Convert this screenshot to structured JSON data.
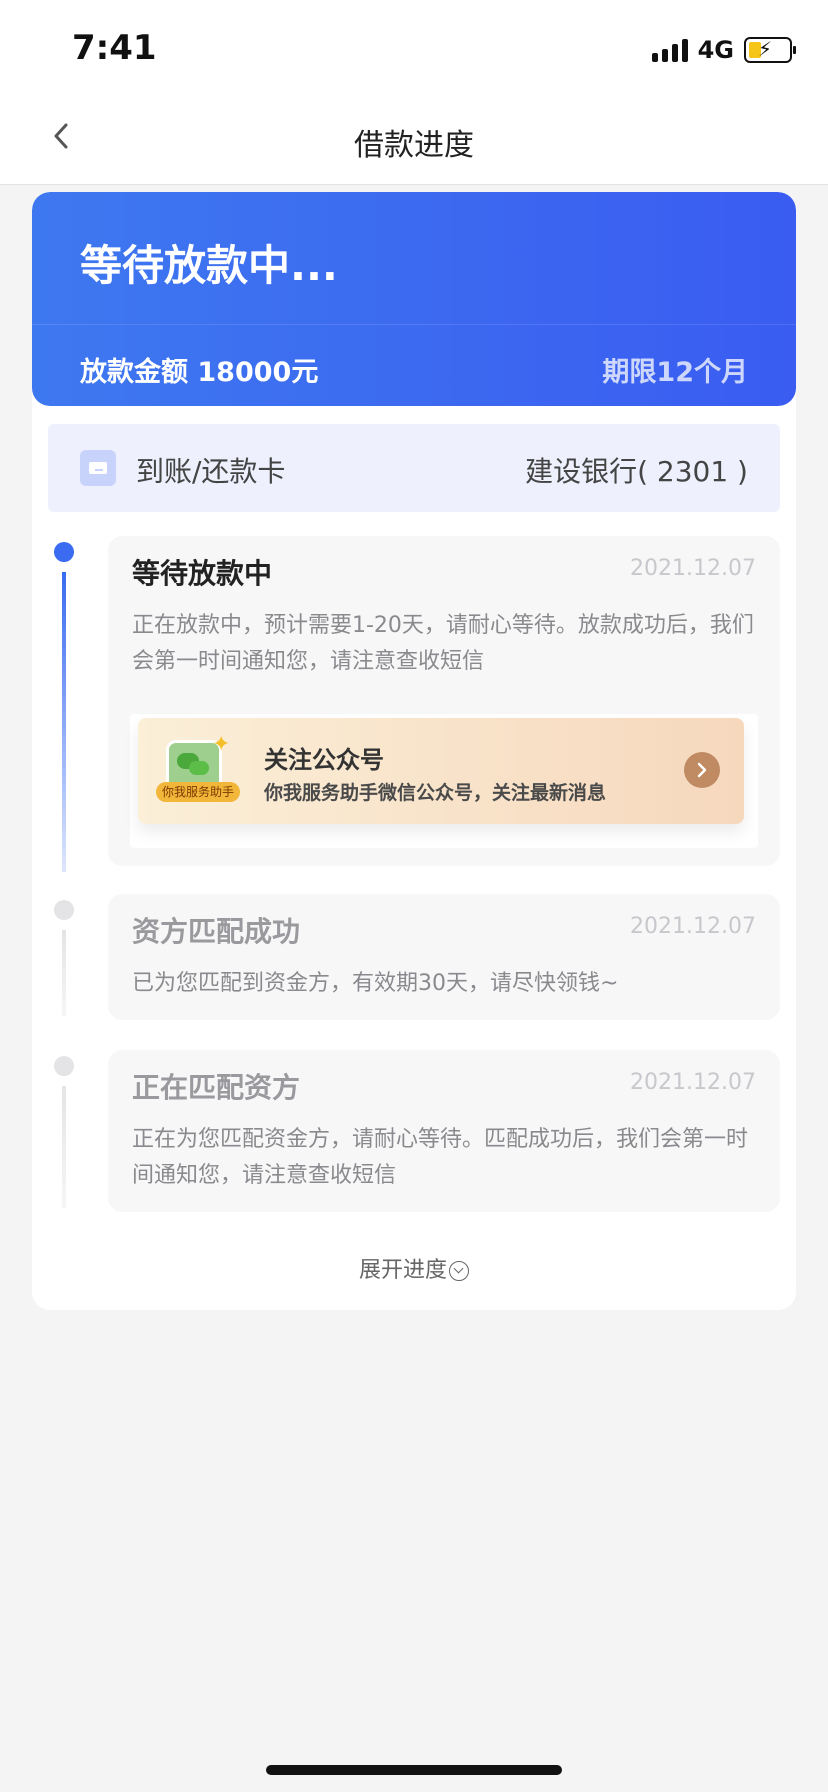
{
  "status_bar": {
    "time": "7:41",
    "network": "4G"
  },
  "nav": {
    "title": "借款进度"
  },
  "hero": {
    "status": "等待放款中...",
    "amount": "放款金额 18000元",
    "term": "期限12个月"
  },
  "bank": {
    "label": "到账/还款卡",
    "value": "建设银行( 2301 )"
  },
  "steps": [
    {
      "title": "等待放款中",
      "date": "2021.12.07",
      "desc": "正在放款中，预计需要1-20天，请耐心等待。放款成功后，我们会第一时间通知您，请注意查收短信",
      "active": true
    },
    {
      "title": "资方匹配成功",
      "date": "2021.12.07",
      "desc": "已为您匹配到资金方，有效期30天，请尽快领钱~",
      "active": false
    },
    {
      "title": "正在匹配资方",
      "date": "2021.12.07",
      "desc": "正在为您匹配资金方，请耐心等待。匹配成功后，我们会第一时间通知您，请注意查收短信",
      "active": false
    }
  ],
  "follow": {
    "badge": "你我服务助手",
    "title": "关注公众号",
    "subtitle": "你我服务助手微信公众号，关注最新消息"
  },
  "expand": {
    "label": "展开进度"
  },
  "colors": {
    "accent": "#3a6bf0",
    "inactive": "#e4e4e6"
  }
}
